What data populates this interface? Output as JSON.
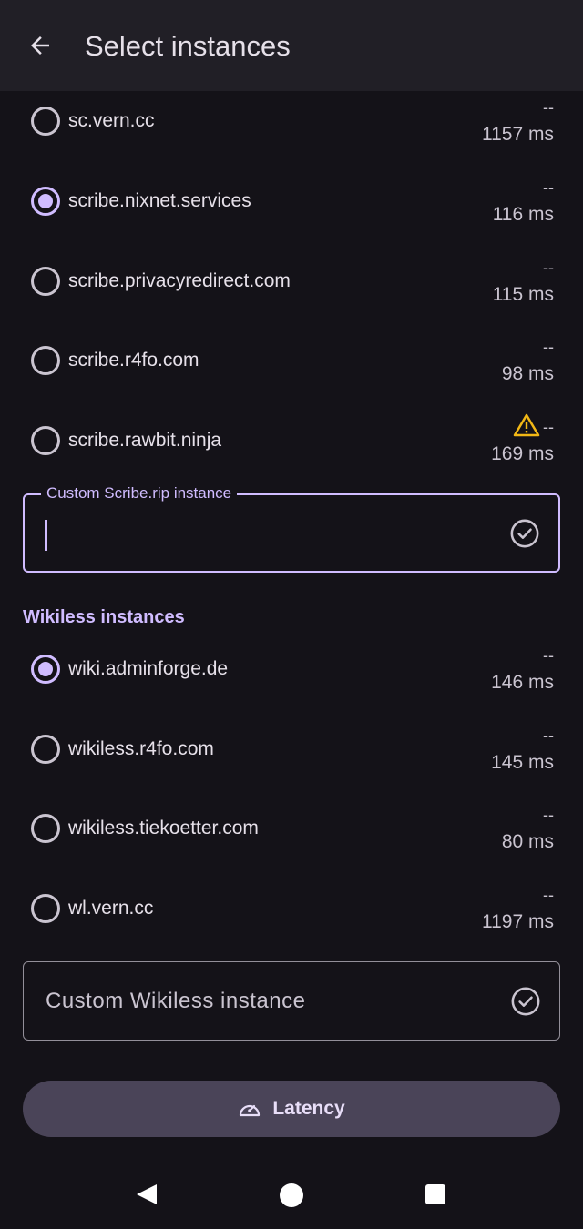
{
  "header": {
    "title": "Select instances"
  },
  "scribe": {
    "instances": [
      {
        "name": "sc.vern.cc",
        "status": "--",
        "latency": "1157 ms",
        "selected": false,
        "warning": false
      },
      {
        "name": "scribe.nixnet.services",
        "status": "--",
        "latency": "116 ms",
        "selected": true,
        "warning": false
      },
      {
        "name": "scribe.privacyredirect.com",
        "status": "--",
        "latency": "115 ms",
        "selected": false,
        "warning": false
      },
      {
        "name": "scribe.r4fo.com",
        "status": "--",
        "latency": "98 ms",
        "selected": false,
        "warning": false
      },
      {
        "name": "scribe.rawbit.ninja",
        "status": "--",
        "latency": "169 ms",
        "selected": false,
        "warning": true
      }
    ],
    "custom_label": "Custom Scribe.rip instance",
    "custom_value": ""
  },
  "wikiless": {
    "header": "Wikiless instances",
    "instances": [
      {
        "name": "wiki.adminforge.de",
        "status": "--",
        "latency": "146 ms",
        "selected": true,
        "warning": false
      },
      {
        "name": "wikiless.r4fo.com",
        "status": "--",
        "latency": "145 ms",
        "selected": false,
        "warning": false
      },
      {
        "name": "wikiless.tiekoetter.com",
        "status": "--",
        "latency": "80 ms",
        "selected": false,
        "warning": false
      },
      {
        "name": "wl.vern.cc",
        "status": "--",
        "latency": "1197 ms",
        "selected": false,
        "warning": false
      }
    ],
    "custom_placeholder": "Custom Wikiless instance"
  },
  "latency_button": {
    "label": "Latency"
  },
  "icons": {
    "back": "arrow-back-icon",
    "check": "check-circle-icon",
    "warning": "warning-icon",
    "speed": "speedometer-icon"
  },
  "colors": {
    "accent": "#d0bcff",
    "background": "#141218",
    "topbar": "#211f26",
    "warning": "#f2b816",
    "button": "#4a4458"
  }
}
